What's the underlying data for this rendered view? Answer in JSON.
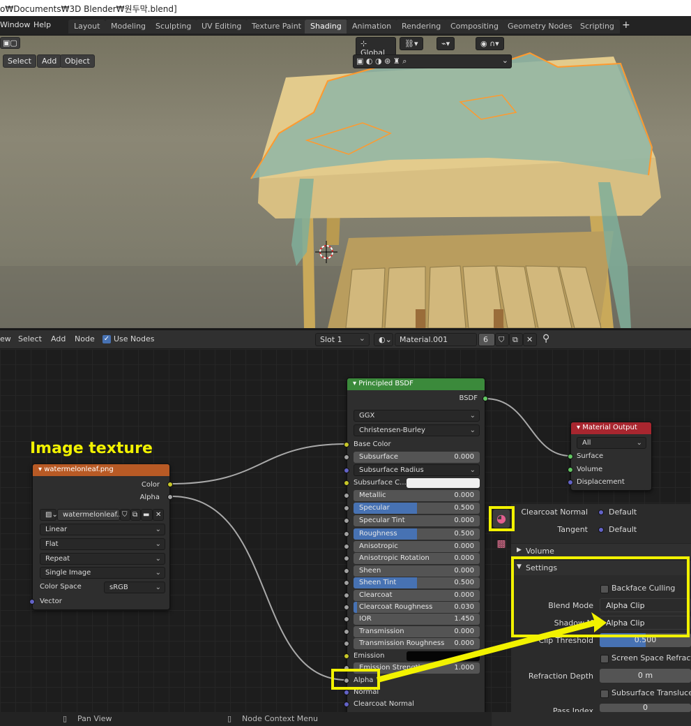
{
  "window": {
    "title": "o₩Documents₩3D Blender₩원두막.blend]"
  },
  "menubar": {
    "menus": [
      "Window",
      "Help"
    ],
    "tabs": [
      "Layout",
      "Modeling",
      "Sculpting",
      "UV Editing",
      "Texture Paint",
      "Shading",
      "Animation",
      "Rendering",
      "Compositing",
      "Geometry Nodes",
      "Scripting"
    ],
    "active_tab": "Shading",
    "add_tab": "+"
  },
  "viewport": {
    "header_menus": [
      "Select",
      "Add",
      "Object"
    ],
    "orientation": "Global"
  },
  "node_editor_header": {
    "menus": [
      "ew",
      "Select",
      "Add",
      "Node"
    ],
    "use_nodes_label": "Use Nodes",
    "slot": "Slot 1",
    "material_name": "Material.001",
    "user_count": "6"
  },
  "annotation": {
    "image_texture_caption": "Image texture"
  },
  "image_node": {
    "title": "watermelonleaf.png",
    "outputs": [
      "Color",
      "Alpha"
    ],
    "image_name": "watermelonleaf...",
    "interpolation": "Linear",
    "projection": "Flat",
    "extension": "Repeat",
    "source": "Single Image",
    "color_space_label": "Color Space",
    "color_space": "sRGB",
    "vector_label": "Vector"
  },
  "bsdf_node": {
    "title": "Principled BSDF",
    "output": "BSDF",
    "distribution": "GGX",
    "subsurface_method": "Christensen-Burley",
    "base_color": "Base Color",
    "subsurface_radius": "Subsurface Radius",
    "subsurface_color": "Subsurface C...",
    "params": [
      {
        "label": "Subsurface",
        "value": "0.000",
        "fill": 0.0
      },
      {
        "label": "Metallic",
        "value": "0.000",
        "fill": 0.0
      },
      {
        "label": "Specular",
        "value": "0.500",
        "fill": 0.5
      },
      {
        "label": "Specular Tint",
        "value": "0.000",
        "fill": 0.0
      },
      {
        "label": "Roughness",
        "value": "0.500",
        "fill": 0.5
      },
      {
        "label": "Anisotropic",
        "value": "0.000",
        "fill": 0.0
      },
      {
        "label": "Anisotropic Rotation",
        "value": "0.000",
        "fill": 0.0
      },
      {
        "label": "Sheen",
        "value": "0.000",
        "fill": 0.0
      },
      {
        "label": "Sheen Tint",
        "value": "0.500",
        "fill": 0.5
      },
      {
        "label": "Clearcoat",
        "value": "0.000",
        "fill": 0.0
      },
      {
        "label": "Clearcoat Roughness",
        "value": "0.030",
        "fill": 0.03
      },
      {
        "label": "IOR",
        "value": "1.450",
        "fill": 0.0
      },
      {
        "label": "Transmission",
        "value": "0.000",
        "fill": 0.0
      },
      {
        "label": "Transmission Roughness",
        "value": "0.000",
        "fill": 0.0
      }
    ],
    "emission": "Emission",
    "emission_strength_label": "Emission Strength",
    "emission_strength": "1.000",
    "alpha": "Alpha",
    "normal": "Normal",
    "clearcoat_normal": "Clearcoat Normal"
  },
  "output_node": {
    "title": "Material Output",
    "target": "All",
    "inputs": [
      "Surface",
      "Volume",
      "Displacement"
    ]
  },
  "properties": {
    "clearcoat_normal_label": "Clearcoat Normal",
    "clearcoat_normal_value": "Default",
    "tangent_label": "Tangent",
    "tangent_value": "Default",
    "volume_panel": "Volume",
    "settings_panel": "Settings",
    "backface_culling": "Backface Culling",
    "blend_mode_label": "Blend Mode",
    "blend_mode": "Alpha Clip",
    "shadow_mode_label": "Shadow M",
    "shadow_mode": "Alpha Clip",
    "clip_threshold_label": "Clip Threshold",
    "clip_threshold": "0.500",
    "clip_threshold_fill": 0.5,
    "ssr_label": "Screen Space Refractio",
    "refraction_depth_label": "Refraction Depth",
    "refraction_depth": "0 m",
    "sss_label": "Subsurface Translucenc",
    "pass_index_label": "Pass Index",
    "pass_index": "0"
  },
  "statusbar": {
    "left": "Pan View",
    "right": "Node Context Menu"
  },
  "colors": {
    "highlight": "#f2f200",
    "accent": "#4772b3",
    "bsdf_header": "#3b8a3b",
    "texture_header": "#b85a25",
    "output_header": "#a8262f"
  }
}
